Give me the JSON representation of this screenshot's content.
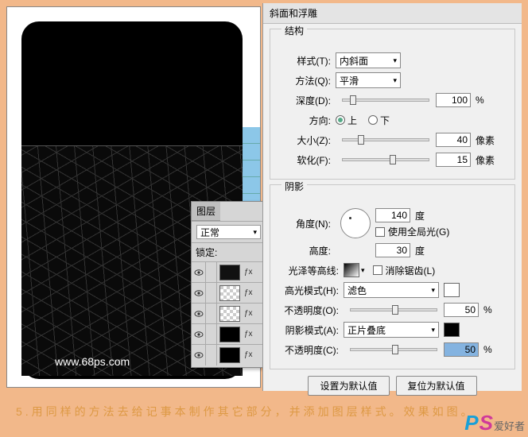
{
  "preview": {
    "url": "www.68ps.com"
  },
  "layers_panel": {
    "tab": "图层",
    "mode": "正常",
    "lock_label": "锁定:"
  },
  "dialog": {
    "title": "斜面和浮雕",
    "structure": {
      "group_label": "结构",
      "style_label": "样式(T):",
      "style_value": "内斜面",
      "method_label": "方法(Q):",
      "method_value": "平滑",
      "depth_label": "深度(D):",
      "depth_value": "100",
      "depth_unit": "%",
      "direction_label": "方向:",
      "up_label": "上",
      "down_label": "下",
      "size_label": "大小(Z):",
      "size_value": "40",
      "size_unit": "像素",
      "soften_label": "软化(F):",
      "soften_value": "15",
      "soften_unit": "像素"
    },
    "shading": {
      "group_label": "阴影",
      "angle_label": "角度(N):",
      "angle_value": "140",
      "angle_unit": "度",
      "global_label": "使用全局光(G)",
      "altitude_label": "高度:",
      "altitude_value": "30",
      "altitude_unit": "度",
      "gloss_label": "光泽等高线:",
      "antialias_label": "消除锯齿(L)",
      "hlmode_label": "高光模式(H):",
      "hlmode_value": "滤色",
      "hlopacity_label": "不透明度(O):",
      "hlopacity_value": "50",
      "hlopacity_unit": "%",
      "shmode_label": "阴影模式(A):",
      "shmode_value": "正片叠底",
      "shopacity_label": "不透明度(C):",
      "shopacity_value": "50",
      "shopacity_unit": "%"
    },
    "buttons": {
      "default": "设置为默认值",
      "reset": "复位为默认值"
    }
  },
  "caption": "5.用同样的方法去给记事本制作其它部分，并添加图层样式。效果如图。",
  "logo": {
    "p": "P",
    "s": "S",
    "cn": "爱好者"
  }
}
